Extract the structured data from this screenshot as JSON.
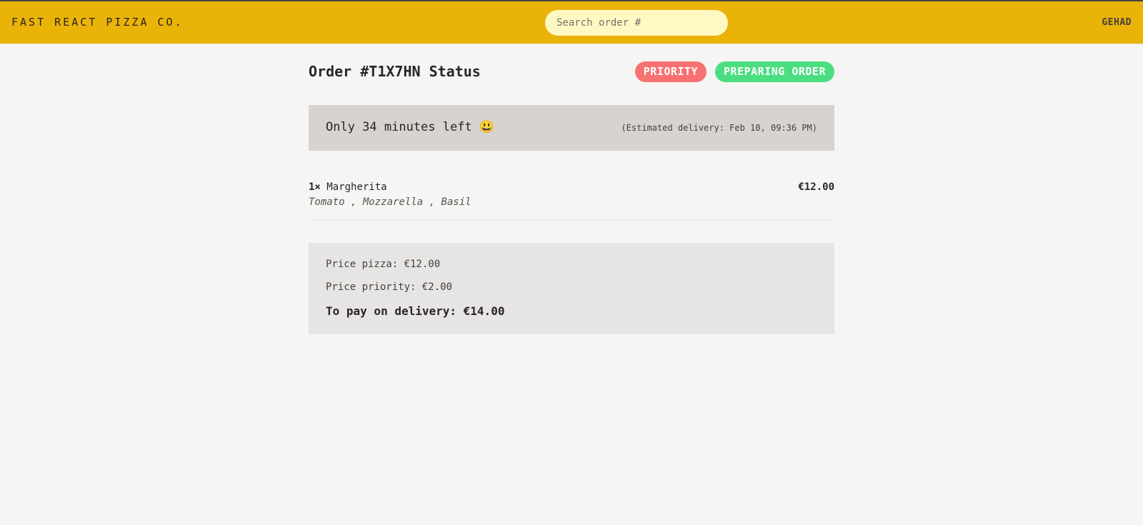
{
  "header": {
    "logo": "Fast React Pizza Co.",
    "search_placeholder": "Search order #",
    "search_value": "",
    "username": "GEHAD",
    "color": "#eab308"
  },
  "order": {
    "title": "Order #T1X7HN Status",
    "badges": {
      "priority": "Priority",
      "status": "Preparing order"
    },
    "eta": {
      "remaining": "Only 34 minutes left 😃",
      "estimated": "(Estimated delivery: Feb 10, 09:36 PM)"
    },
    "items": [
      {
        "quantity": "1×",
        "name": "Margherita",
        "price": "€12.00",
        "ingredients": "Tomato , Mozzarella , Basil"
      }
    ],
    "summary": {
      "price_pizza": "Price pizza: €12.00",
      "price_priority": "Price priority: €2.00",
      "total": "To pay on delivery: €14.00"
    }
  },
  "colors": {
    "priority_badge": "#f87171",
    "status_badge": "#4ade80",
    "eta_bg": "#d6d3d1",
    "summary_bg": "#e7e5e4"
  }
}
